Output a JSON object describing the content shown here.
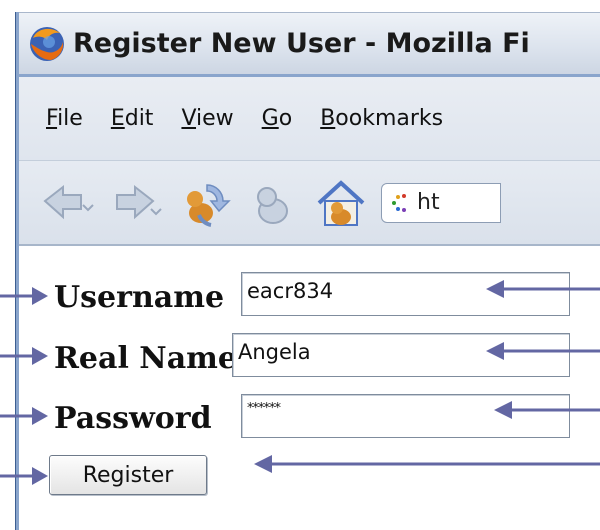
{
  "window": {
    "title": "Register New User - Mozilla Fi",
    "app_icon": "firefox-globe-icon"
  },
  "menubar": {
    "items": [
      {
        "prefix": "",
        "accel": "F",
        "rest": "ile"
      },
      {
        "prefix": "",
        "accel": "E",
        "rest": "dit"
      },
      {
        "prefix": "",
        "accel": "V",
        "rest": "iew"
      },
      {
        "prefix": "",
        "accel": "G",
        "rest": "o"
      },
      {
        "prefix": "",
        "accel": "B",
        "rest": "ookmarks"
      }
    ]
  },
  "toolbar": {
    "icons": [
      "back-icon",
      "forward-icon",
      "reload-icon",
      "stop-icon",
      "home-icon"
    ],
    "url_text": "ht"
  },
  "form": {
    "username_label": "Username",
    "username_value": "eacr834",
    "realname_label": "Real Name",
    "realname_value": "Angela",
    "password_label": "Password",
    "password_value": "******",
    "register_label": "Register"
  },
  "colors": {
    "arrow": "#6367a3",
    "frame": "#8aa5cc"
  }
}
